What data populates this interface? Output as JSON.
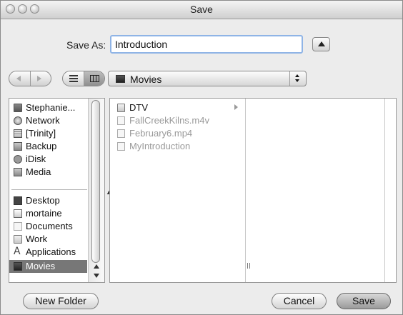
{
  "window": {
    "title": "Save"
  },
  "save_as": {
    "label": "Save As:",
    "value": "Introduction"
  },
  "location": {
    "selected": "Movies"
  },
  "sidebar": {
    "devices": [
      {
        "label": "Stephanie...",
        "icon": "computer-icon"
      },
      {
        "label": "Network",
        "icon": "network-icon"
      },
      {
        "label": "[Trinity]",
        "icon": "server-icon"
      },
      {
        "label": "Backup",
        "icon": "disk-icon"
      },
      {
        "label": "iDisk",
        "icon": "idisk-icon"
      },
      {
        "label": "Media",
        "icon": "disk-icon"
      }
    ],
    "places": [
      {
        "label": "Desktop",
        "icon": "desktop-icon"
      },
      {
        "label": "mortaine",
        "icon": "home-icon"
      },
      {
        "label": "Documents",
        "icon": "document-icon"
      },
      {
        "label": "Work",
        "icon": "folder-icon"
      },
      {
        "label": "Applications",
        "icon": "applications-icon"
      },
      {
        "label": "Movies",
        "icon": "movies-icon",
        "selected": true
      }
    ]
  },
  "browser": {
    "column1": [
      {
        "label": "DTV",
        "icon": "folder-icon",
        "enabled": true,
        "has_children": true
      },
      {
        "label": "FallCreekKilns.m4v",
        "icon": "movie-file-icon",
        "enabled": false
      },
      {
        "label": "February6.mp4",
        "icon": "movie-file-icon",
        "enabled": false
      },
      {
        "label": "MyIntroduction",
        "icon": "project-file-icon",
        "enabled": false
      }
    ]
  },
  "buttons": {
    "new_folder": "New Folder",
    "cancel": "Cancel",
    "save": "Save"
  },
  "colors": {
    "focus_ring": "#8fb4e6",
    "selection": "#777777",
    "disabled_text": "#9a9a9a"
  }
}
